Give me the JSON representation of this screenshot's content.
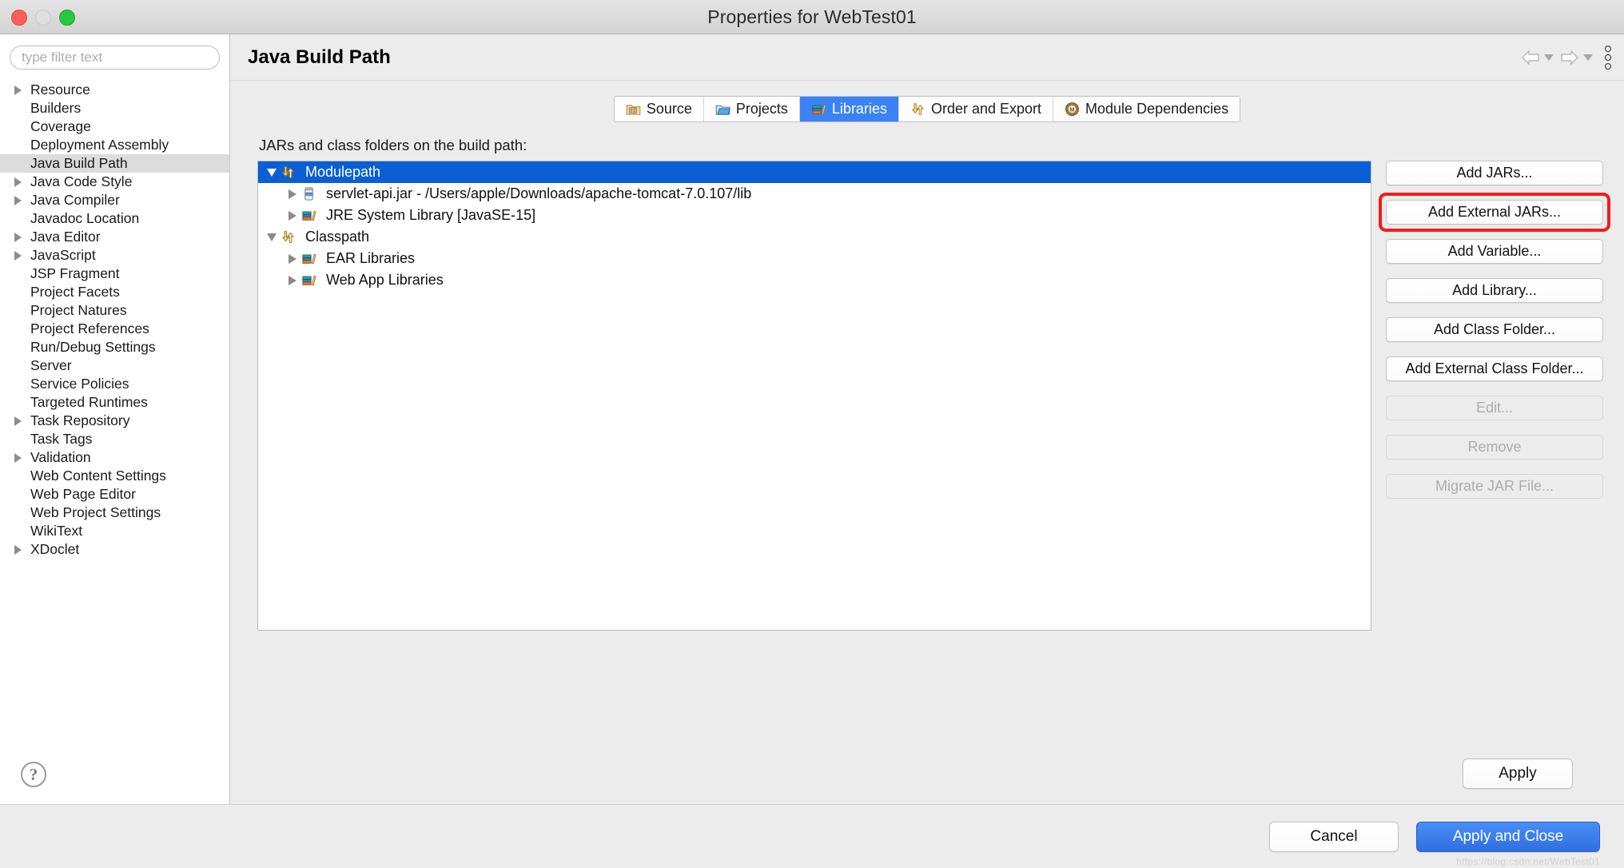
{
  "window": {
    "title": "Properties for WebTest01",
    "traffic_lights": [
      "close-red",
      "minimize-yellow",
      "maximize-green"
    ]
  },
  "sidebar": {
    "filter": {
      "value": "",
      "placeholder": "type filter text"
    },
    "items": [
      {
        "label": "Resource",
        "expandable": true,
        "selected": false
      },
      {
        "label": "Builders",
        "expandable": false,
        "selected": false
      },
      {
        "label": "Coverage",
        "expandable": false,
        "selected": false
      },
      {
        "label": "Deployment Assembly",
        "expandable": false,
        "selected": false
      },
      {
        "label": "Java Build Path",
        "expandable": false,
        "selected": true
      },
      {
        "label": "Java Code Style",
        "expandable": true,
        "selected": false
      },
      {
        "label": "Java Compiler",
        "expandable": true,
        "selected": false
      },
      {
        "label": "Javadoc Location",
        "expandable": false,
        "selected": false
      },
      {
        "label": "Java Editor",
        "expandable": true,
        "selected": false
      },
      {
        "label": "JavaScript",
        "expandable": true,
        "selected": false
      },
      {
        "label": "JSP Fragment",
        "expandable": false,
        "selected": false
      },
      {
        "label": "Project Facets",
        "expandable": false,
        "selected": false
      },
      {
        "label": "Project Natures",
        "expandable": false,
        "selected": false
      },
      {
        "label": "Project References",
        "expandable": false,
        "selected": false
      },
      {
        "label": "Run/Debug Settings",
        "expandable": false,
        "selected": false
      },
      {
        "label": "Server",
        "expandable": false,
        "selected": false
      },
      {
        "label": "Service Policies",
        "expandable": false,
        "selected": false
      },
      {
        "label": "Targeted Runtimes",
        "expandable": false,
        "selected": false
      },
      {
        "label": "Task Repository",
        "expandable": true,
        "selected": false
      },
      {
        "label": "Task Tags",
        "expandable": false,
        "selected": false
      },
      {
        "label": "Validation",
        "expandable": true,
        "selected": false
      },
      {
        "label": "Web Content Settings",
        "expandable": false,
        "selected": false
      },
      {
        "label": "Web Page Editor",
        "expandable": false,
        "selected": false
      },
      {
        "label": "Web Project Settings",
        "expandable": false,
        "selected": false
      },
      {
        "label": "WikiText",
        "expandable": false,
        "selected": false
      },
      {
        "label": "XDoclet",
        "expandable": true,
        "selected": false
      }
    ],
    "help_glyph": "?"
  },
  "pane": {
    "title": "Java Build Path",
    "nav": {
      "back_icon": "back-arrow-icon",
      "back_dropdown_icon": "chevron-down-icon",
      "forward_icon": "forward-arrow-icon",
      "forward_dropdown_icon": "chevron-down-icon",
      "menu_icon": "vertical-dots-menu-icon"
    }
  },
  "tabs": [
    {
      "label": "Source",
      "icon": "source-folder-icon",
      "active": false
    },
    {
      "label": "Projects",
      "icon": "projects-folder-icon",
      "active": false
    },
    {
      "label": "Libraries",
      "icon": "libraries-books-icon",
      "active": true
    },
    {
      "label": "Order and Export",
      "icon": "order-export-arrows-icon",
      "active": false
    },
    {
      "label": "Module Dependencies",
      "icon": "module-m-icon",
      "active": false
    }
  ],
  "main": {
    "group_label": "JARs and class folders on the build path:",
    "tree": [
      {
        "label": "Modulepath",
        "icon": "modulepath-arrows-icon",
        "state": "open",
        "indent": 1,
        "selected": true
      },
      {
        "label": "servlet-api.jar - /Users/apple/Downloads/apache-tomcat-7.0.107/lib",
        "icon": "jar-icon",
        "state": "closed",
        "indent": 2,
        "selected": false
      },
      {
        "label": "JRE System Library [JavaSE-15]",
        "icon": "libraries-books-icon",
        "state": "closed",
        "indent": 2,
        "selected": false
      },
      {
        "label": "Classpath",
        "icon": "classpath-arrows-icon",
        "state": "open",
        "indent": 1,
        "selected": false
      },
      {
        "label": "EAR Libraries",
        "icon": "libraries-books-icon",
        "state": "closed",
        "indent": 2,
        "selected": false
      },
      {
        "label": "Web App Libraries",
        "icon": "libraries-books-icon",
        "state": "closed",
        "indent": 2,
        "selected": false
      }
    ],
    "side_buttons": [
      {
        "label": "Add JARs...",
        "enabled": true,
        "highlighted": false
      },
      {
        "label": "Add External JARs...",
        "enabled": true,
        "highlighted": true
      },
      {
        "label": "Add Variable...",
        "enabled": true,
        "highlighted": false
      },
      {
        "label": "Add Library...",
        "enabled": true,
        "highlighted": false
      },
      {
        "label": "Add Class Folder...",
        "enabled": true,
        "highlighted": false
      },
      {
        "label": "Add External Class Folder...",
        "enabled": true,
        "highlighted": false
      },
      {
        "label": "Edit...",
        "enabled": false,
        "highlighted": false
      },
      {
        "label": "Remove",
        "enabled": false,
        "highlighted": false
      },
      {
        "label": "Migrate JAR File...",
        "enabled": false,
        "highlighted": false
      }
    ],
    "apply_label": "Apply"
  },
  "footer": {
    "cancel_label": "Cancel",
    "primary_label": "Apply and Close",
    "watermark": "https://blog.csdn.net/WebTest01"
  },
  "colors": {
    "selection_blue": "#0a5fd4",
    "tab_active_blue": "#3a82f6",
    "primary_button_blue": "#2f6fe0",
    "highlight_red": "#f61b1b",
    "sidebar_selected_gray": "#dcdcdc"
  }
}
